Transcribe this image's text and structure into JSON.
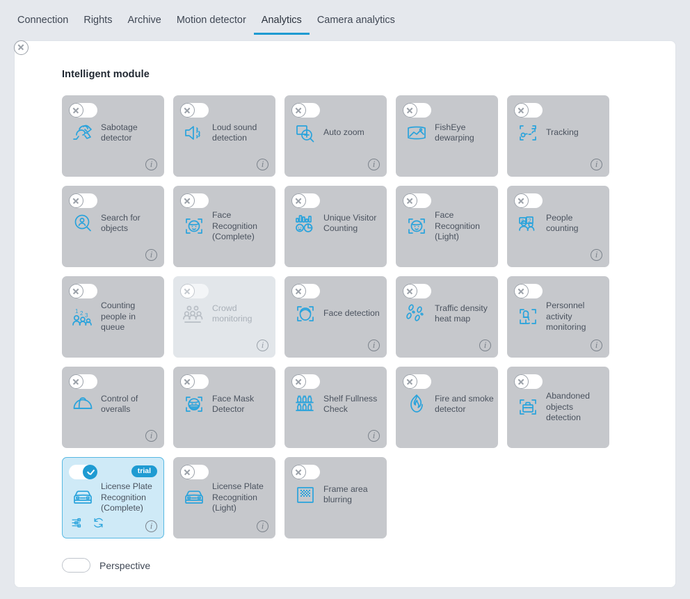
{
  "tabs": [
    {
      "label": "Connection",
      "active": false
    },
    {
      "label": "Rights",
      "active": false
    },
    {
      "label": "Archive",
      "active": false
    },
    {
      "label": "Motion detector",
      "active": false
    },
    {
      "label": "Analytics",
      "active": true
    },
    {
      "label": "Camera analytics",
      "active": false
    }
  ],
  "section": {
    "title": "Intelligent module"
  },
  "colors": {
    "accent": "#1f9bd2",
    "icon_blue": "#29a3dc",
    "card_bg": "#c6c8cc",
    "card_bg_disabled": "#e2e6ea",
    "card_bg_active": "#cfeaf7",
    "page_bg": "#e5e8ed",
    "panel_bg": "#ffffff",
    "text": "#4a525e"
  },
  "modules": [
    {
      "label": "Sabotage detector",
      "icon": "sabotage-detector-icon",
      "enabled": false,
      "available": true,
      "info": true
    },
    {
      "label": "Loud sound detection",
      "icon": "loud-sound-icon",
      "enabled": false,
      "available": true,
      "info": true
    },
    {
      "label": "Auto zoom",
      "icon": "auto-zoom-icon",
      "enabled": false,
      "available": true,
      "info": true
    },
    {
      "label": "FishEye dewarping",
      "icon": "fisheye-dewarping-icon",
      "enabled": false,
      "available": true,
      "info": false
    },
    {
      "label": "Tracking",
      "icon": "tracking-icon",
      "enabled": false,
      "available": true,
      "info": true
    },
    {
      "label": "Search for objects",
      "icon": "search-objects-icon",
      "enabled": false,
      "available": true,
      "info": true
    },
    {
      "label": "Face Recognition (Complete)",
      "icon": "face-recognition-icon",
      "enabled": false,
      "available": true,
      "info": false
    },
    {
      "label": "Unique Visitor Counting",
      "icon": "unique-visitor-counting-icon",
      "enabled": false,
      "available": true,
      "info": false
    },
    {
      "label": "Face Recognition (Light)",
      "icon": "face-recognition-icon",
      "enabled": false,
      "available": true,
      "info": false
    },
    {
      "label": "People counting",
      "icon": "people-counting-icon",
      "enabled": false,
      "available": true,
      "info": true
    },
    {
      "label": "Counting people in queue",
      "icon": "counting-queue-icon",
      "enabled": false,
      "available": true,
      "info": false
    },
    {
      "label": "Crowd monitoring",
      "icon": "crowd-monitoring-icon",
      "enabled": false,
      "available": false,
      "info": true
    },
    {
      "label": "Face detection",
      "icon": "face-detection-icon",
      "enabled": false,
      "available": true,
      "info": true
    },
    {
      "label": "Traffic density heat map",
      "icon": "heat-map-icon",
      "enabled": false,
      "available": true,
      "info": true
    },
    {
      "label": "Personnel activity monitoring",
      "icon": "personnel-activity-icon",
      "enabled": false,
      "available": true,
      "info": true
    },
    {
      "label": "Control of overalls",
      "icon": "hardhat-icon",
      "enabled": false,
      "available": true,
      "info": true
    },
    {
      "label": "Face Mask Detector",
      "icon": "face-mask-icon",
      "enabled": false,
      "available": true,
      "info": false
    },
    {
      "label": "Shelf Fullness Check",
      "icon": "shelf-fullness-icon",
      "enabled": false,
      "available": true,
      "info": true
    },
    {
      "label": "Fire and smoke detector",
      "icon": "fire-smoke-icon",
      "enabled": false,
      "available": true,
      "info": false
    },
    {
      "label": "Abandoned objects detection",
      "icon": "abandoned-objects-icon",
      "enabled": false,
      "available": true,
      "info": false
    },
    {
      "label": "License Plate Recognition (Complete)",
      "icon": "license-plate-icon",
      "enabled": true,
      "available": true,
      "info": true,
      "badge": "trial",
      "actions": [
        "settings-sliders-icon",
        "sync-icon"
      ]
    },
    {
      "label": "License Plate Recognition (Light)",
      "icon": "license-plate-icon",
      "enabled": false,
      "available": true,
      "info": true
    },
    {
      "label": "Frame area blurring",
      "icon": "frame-blur-icon",
      "enabled": false,
      "available": true,
      "info": false
    }
  ],
  "perspective": {
    "label": "Perspective",
    "enabled": false
  }
}
